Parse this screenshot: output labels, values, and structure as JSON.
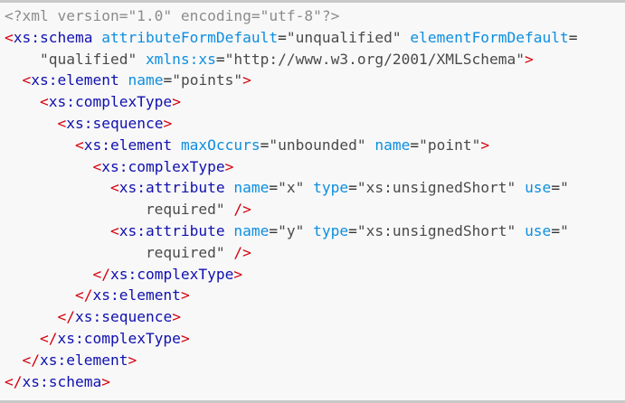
{
  "code_viewer": {
    "lines": [
      {
        "indent": "",
        "tokens": [
          {
            "t": "decl",
            "v": "<?xml version=\"1.0\" encoding=\"utf-8\"?>"
          }
        ]
      },
      {
        "indent": "",
        "tokens": [
          {
            "t": "brk",
            "v": "<"
          },
          {
            "t": "tag",
            "v": "xs:schema"
          },
          {
            "t": "sp",
            "v": " "
          },
          {
            "t": "an",
            "v": "attributeFormDefault"
          },
          {
            "t": "eq",
            "v": "="
          },
          {
            "t": "val",
            "v": "\"unqualified\""
          },
          {
            "t": "sp",
            "v": " "
          },
          {
            "t": "an",
            "v": "elementFormDefault"
          },
          {
            "t": "eq",
            "v": "="
          }
        ]
      },
      {
        "indent": "    ",
        "tokens": [
          {
            "t": "val",
            "v": "\"qualified\""
          },
          {
            "t": "sp",
            "v": " "
          },
          {
            "t": "an",
            "v": "xmlns:xs"
          },
          {
            "t": "eq",
            "v": "="
          },
          {
            "t": "val",
            "v": "\"http://www.w3.org/2001/XMLSchema\""
          },
          {
            "t": "brk",
            "v": ">"
          }
        ]
      },
      {
        "indent": "  ",
        "tokens": [
          {
            "t": "brk",
            "v": "<"
          },
          {
            "t": "tag",
            "v": "xs:element"
          },
          {
            "t": "sp",
            "v": " "
          },
          {
            "t": "an",
            "v": "name"
          },
          {
            "t": "eq",
            "v": "="
          },
          {
            "t": "val",
            "v": "\"points\""
          },
          {
            "t": "brk",
            "v": ">"
          }
        ]
      },
      {
        "indent": "    ",
        "tokens": [
          {
            "t": "brk",
            "v": "<"
          },
          {
            "t": "tag",
            "v": "xs:complexType"
          },
          {
            "t": "brk",
            "v": ">"
          }
        ]
      },
      {
        "indent": "      ",
        "tokens": [
          {
            "t": "brk",
            "v": "<"
          },
          {
            "t": "tag",
            "v": "xs:sequence"
          },
          {
            "t": "brk",
            "v": ">"
          }
        ]
      },
      {
        "indent": "        ",
        "tokens": [
          {
            "t": "brk",
            "v": "<"
          },
          {
            "t": "tag",
            "v": "xs:element"
          },
          {
            "t": "sp",
            "v": " "
          },
          {
            "t": "an",
            "v": "maxOccurs"
          },
          {
            "t": "eq",
            "v": "="
          },
          {
            "t": "val",
            "v": "\"unbounded\""
          },
          {
            "t": "sp",
            "v": " "
          },
          {
            "t": "an",
            "v": "name"
          },
          {
            "t": "eq",
            "v": "="
          },
          {
            "t": "val",
            "v": "\"point\""
          },
          {
            "t": "brk",
            "v": ">"
          }
        ]
      },
      {
        "indent": "          ",
        "tokens": [
          {
            "t": "brk",
            "v": "<"
          },
          {
            "t": "tag",
            "v": "xs:complexType"
          },
          {
            "t": "brk",
            "v": ">"
          }
        ]
      },
      {
        "indent": "            ",
        "tokens": [
          {
            "t": "brk",
            "v": "<"
          },
          {
            "t": "tag",
            "v": "xs:attribute"
          },
          {
            "t": "sp",
            "v": " "
          },
          {
            "t": "an",
            "v": "name"
          },
          {
            "t": "eq",
            "v": "="
          },
          {
            "t": "val",
            "v": "\"x\""
          },
          {
            "t": "sp",
            "v": " "
          },
          {
            "t": "an",
            "v": "type"
          },
          {
            "t": "eq",
            "v": "="
          },
          {
            "t": "val",
            "v": "\"xs:unsignedShort\""
          },
          {
            "t": "sp",
            "v": " "
          },
          {
            "t": "an",
            "v": "use"
          },
          {
            "t": "eq",
            "v": "="
          },
          {
            "t": "val",
            "v": "\""
          }
        ]
      },
      {
        "indent": "                ",
        "tokens": [
          {
            "t": "val",
            "v": "required\""
          },
          {
            "t": "sp",
            "v": " "
          },
          {
            "t": "brk",
            "v": "/>"
          }
        ]
      },
      {
        "indent": "            ",
        "tokens": [
          {
            "t": "brk",
            "v": "<"
          },
          {
            "t": "tag",
            "v": "xs:attribute"
          },
          {
            "t": "sp",
            "v": " "
          },
          {
            "t": "an",
            "v": "name"
          },
          {
            "t": "eq",
            "v": "="
          },
          {
            "t": "val",
            "v": "\"y\""
          },
          {
            "t": "sp",
            "v": " "
          },
          {
            "t": "an",
            "v": "type"
          },
          {
            "t": "eq",
            "v": "="
          },
          {
            "t": "val",
            "v": "\"xs:unsignedShort\""
          },
          {
            "t": "sp",
            "v": " "
          },
          {
            "t": "an",
            "v": "use"
          },
          {
            "t": "eq",
            "v": "="
          },
          {
            "t": "val",
            "v": "\""
          }
        ]
      },
      {
        "indent": "                ",
        "tokens": [
          {
            "t": "val",
            "v": "required\""
          },
          {
            "t": "sp",
            "v": " "
          },
          {
            "t": "brk",
            "v": "/>"
          }
        ]
      },
      {
        "indent": "          ",
        "tokens": [
          {
            "t": "brk",
            "v": "</"
          },
          {
            "t": "tag",
            "v": "xs:complexType"
          },
          {
            "t": "brk",
            "v": ">"
          }
        ]
      },
      {
        "indent": "        ",
        "tokens": [
          {
            "t": "brk",
            "v": "</"
          },
          {
            "t": "tag",
            "v": "xs:element"
          },
          {
            "t": "brk",
            "v": ">"
          }
        ]
      },
      {
        "indent": "      ",
        "tokens": [
          {
            "t": "brk",
            "v": "</"
          },
          {
            "t": "tag",
            "v": "xs:sequence"
          },
          {
            "t": "brk",
            "v": ">"
          }
        ]
      },
      {
        "indent": "    ",
        "tokens": [
          {
            "t": "brk",
            "v": "</"
          },
          {
            "t": "tag",
            "v": "xs:complexType"
          },
          {
            "t": "brk",
            "v": ">"
          }
        ]
      },
      {
        "indent": "  ",
        "tokens": [
          {
            "t": "brk",
            "v": "</"
          },
          {
            "t": "tag",
            "v": "xs:element"
          },
          {
            "t": "brk",
            "v": ">"
          }
        ]
      },
      {
        "indent": "",
        "tokens": [
          {
            "t": "brk",
            "v": "</"
          },
          {
            "t": "tag",
            "v": "xs:schema"
          },
          {
            "t": "brk",
            "v": ">"
          }
        ]
      }
    ]
  },
  "colors": {
    "background": "#f8f8f8",
    "border": "#c9c9c9",
    "declaration": "#8c8c8c",
    "bracket": "#d5000d",
    "tag_name": "#1010b0",
    "attribute_name": "#0d8ee0",
    "attribute_value": "#4a4a4a"
  }
}
